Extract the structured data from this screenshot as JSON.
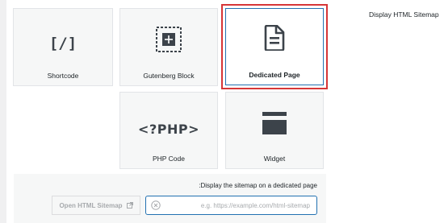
{
  "sidebar": {
    "title": "Display HTML Sitemap"
  },
  "options": [
    {
      "label": "Shortcode",
      "icon": "shortcode-brackets-icon",
      "glyph": "[/]"
    },
    {
      "label": "Gutenberg Block",
      "icon": "block-add-icon"
    },
    {
      "label": "Dedicated Page",
      "icon": "document-page-icon",
      "selected": true
    },
    {
      "label": "PHP Code",
      "icon": "php-code-icon",
      "glyph": "<?PHP>"
    },
    {
      "label": "Widget",
      "icon": "widget-layout-icon"
    }
  ],
  "dedicated": {
    "description": ":Display the sitemap on a dedicated page",
    "open_button_label": "Open HTML Sitemap",
    "url_value": "",
    "url_placeholder": "e.g. https://example.com/html-sitemap"
  },
  "colors": {
    "selected_border": "#2271b1",
    "highlight": "#d63638",
    "icon": "#3c434a"
  }
}
